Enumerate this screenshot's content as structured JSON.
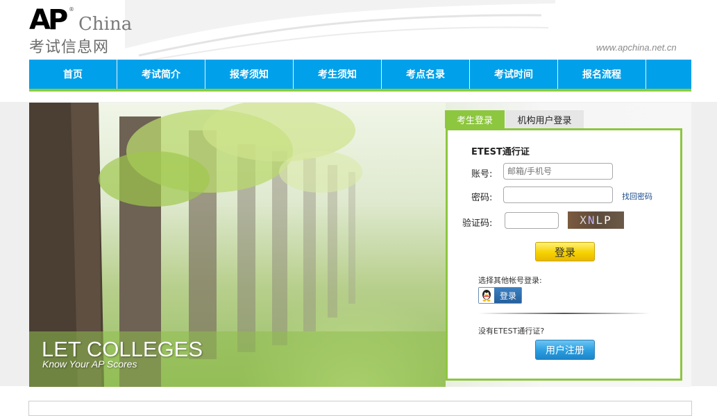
{
  "logo": {
    "ap": "AP",
    "reg": "®",
    "china": "China",
    "subtitle": "考试信息网"
  },
  "site_url": "www.apchina.net.cn",
  "nav": {
    "items": [
      "首页",
      "考试简介",
      "报考须知",
      "考生须知",
      "考点名录",
      "考试时间",
      "报名流程"
    ]
  },
  "banner": {
    "headline": "LET COLLEGES",
    "tagline": "Know Your AP Scores"
  },
  "login": {
    "tabs": {
      "active": "考生登录",
      "inactive": "机构用户登录"
    },
    "title": "ETEST通行证",
    "account_label": "账号:",
    "account_placeholder": "邮箱/手机号",
    "password_label": "密码:",
    "forgot_password": "找回密码",
    "captcha_label": "验证码:",
    "captcha_text": [
      "X",
      "N",
      "L",
      "P"
    ],
    "login_button": "登录",
    "other_login_label": "选择其他帐号登录:",
    "qq_login": "登录",
    "no_account": "没有ETEST通行证?",
    "register_button": "用户注册"
  },
  "colors": {
    "nav_blue": "#00a0ea",
    "accent_green": "#8dc63f"
  }
}
